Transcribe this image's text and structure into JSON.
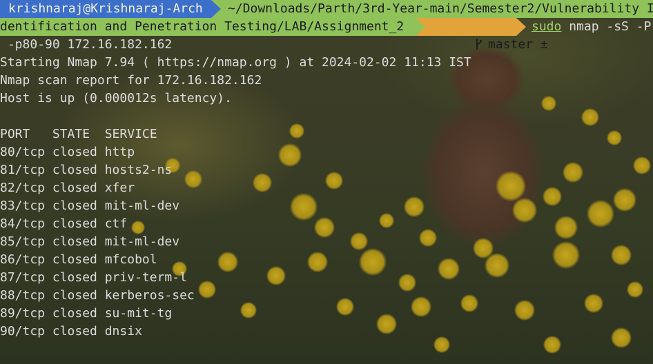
{
  "prompt": {
    "user_host": "krishnaraj@Krishnaraj-Arch",
    "path_line1": "~/Downloads/Parth/3rd-Year-main/Semester2/Vulnerability I",
    "path_line2": "dentification and Penetration Testing/LAB/Assignment_2",
    "git_branch": "master ±",
    "command_sudo": "sudo",
    "command_rest": " nmap -sS -P",
    "command_cont": " -p80-90 172.16.182.162"
  },
  "output": {
    "lines": [
      "Starting Nmap 7.94 ( https://nmap.org ) at 2024-02-02 11:13 IST",
      "Nmap scan report for 172.16.182.162",
      "Host is up (0.000012s latency).",
      "",
      "PORT   STATE  SERVICE",
      "80/tcp closed http",
      "81/tcp closed hosts2-ns",
      "82/tcp closed xfer",
      "83/tcp closed mit-ml-dev",
      "84/tcp closed ctf",
      "85/tcp closed mit-ml-dev",
      "86/tcp closed mfcobol",
      "87/tcp closed priv-term-l",
      "88/tcp closed kerberos-sec",
      "89/tcp closed su-mit-tg",
      "90/tcp closed dnsix"
    ]
  },
  "colors": {
    "user_segment": "#3b6fc9",
    "path_segment": "#8fc35a",
    "git_segment": "#e2a33a",
    "sudo_text": "#9fd36b",
    "output_text": "#dcdcdc"
  },
  "icons": {
    "branch": "git-branch-icon"
  }
}
